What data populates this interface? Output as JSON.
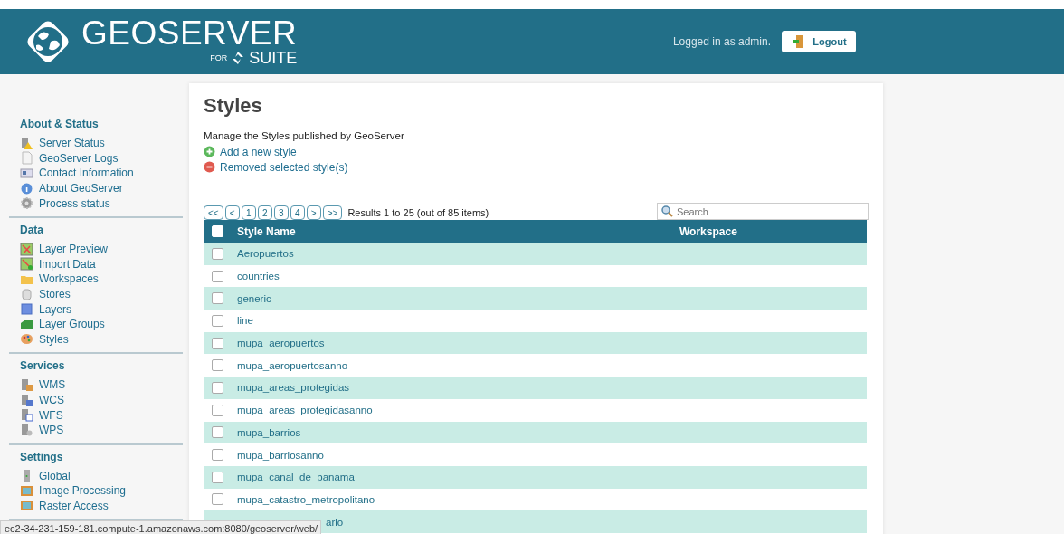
{
  "header": {
    "logo_text": "GEOSERVER",
    "logo_for": "FOR",
    "logo_suite": "SUITE",
    "login_status": "Logged in as admin.",
    "logout_button": "Logout"
  },
  "sidebar": {
    "sections": [
      {
        "title": "About & Status",
        "items": [
          {
            "label": "Server Status"
          },
          {
            "label": "GeoServer Logs"
          },
          {
            "label": "Contact Information"
          },
          {
            "label": "About GeoServer"
          },
          {
            "label": "Process status"
          }
        ]
      },
      {
        "title": "Data",
        "items": [
          {
            "label": "Layer Preview"
          },
          {
            "label": "Import Data"
          },
          {
            "label": "Workspaces"
          },
          {
            "label": "Stores"
          },
          {
            "label": "Layers"
          },
          {
            "label": "Layer Groups"
          },
          {
            "label": "Styles"
          }
        ]
      },
      {
        "title": "Services",
        "items": [
          {
            "label": "WMS"
          },
          {
            "label": "WCS"
          },
          {
            "label": "WFS"
          },
          {
            "label": "WPS"
          }
        ]
      },
      {
        "title": "Settings",
        "items": [
          {
            "label": "Global"
          },
          {
            "label": "Image Processing"
          },
          {
            "label": "Raster Access"
          }
        ]
      }
    ]
  },
  "page": {
    "title": "Styles",
    "description": "Manage the Styles published by GeoServer",
    "actions": [
      {
        "kind": "add",
        "label": "Add a new style"
      },
      {
        "kind": "remove",
        "label": "Removed selected style(s)"
      }
    ]
  },
  "pager": {
    "buttons": [
      {
        "label": "<<"
      },
      {
        "label": "<"
      },
      {
        "label": "1"
      },
      {
        "label": "2"
      },
      {
        "label": "3"
      },
      {
        "label": "4"
      },
      {
        "label": ">"
      },
      {
        "label": ">>"
      }
    ],
    "summary": "Results 1 to 25 (out of 85 items)"
  },
  "search": {
    "placeholder": "Search"
  },
  "table": {
    "columns": [
      "Style Name",
      "Workspace"
    ],
    "select_all": {
      "checked": false
    },
    "rows": [
      {
        "name": "Aeropuertos",
        "selected": false
      },
      {
        "name": "countries",
        "selected": false
      },
      {
        "name": "generic",
        "selected": false
      },
      {
        "name": "line",
        "selected": false
      },
      {
        "name": "mupa_aeropuertos",
        "selected": false
      },
      {
        "name": "mupa_aeropuertosanno",
        "selected": false
      },
      {
        "name": "mupa_areas_protegidas",
        "selected": false
      },
      {
        "name": "mupa_areas_protegidasanno",
        "selected": false
      },
      {
        "name": "mupa_barrios",
        "selected": false
      },
      {
        "name": "mupa_barriosanno",
        "selected": false
      },
      {
        "name": "mupa_canal_de_panama",
        "selected": false
      },
      {
        "name": "mupa_catastro_metropolitano",
        "selected": false
      },
      {
        "name": "ario",
        "kind": "covered"
      }
    ]
  },
  "status_bar": {
    "url": "ec2-34-231-159-181.compute-1.amazonaws.com:8080/geoserver/web/"
  }
}
